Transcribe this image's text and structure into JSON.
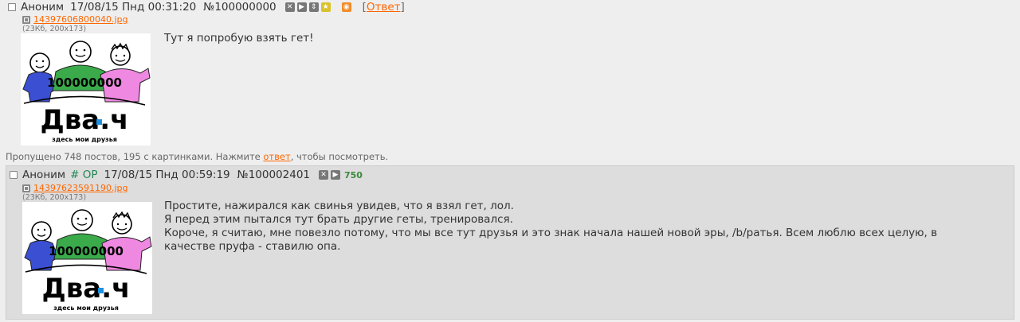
{
  "posts": [
    {
      "name": "Аноним",
      "date": "17/08/15 Пнд 00:31:20",
      "number": "№100000000",
      "reply_link_label": "Ответ",
      "file": {
        "name": "14397606800040.jpg",
        "meta": "(23Кб, 200x173)"
      },
      "message": "Тут я попробую взять гет!",
      "thumb": {
        "number": "100000000",
        "logo": "Два.ч",
        "tagline": "здесь мои друзья"
      }
    },
    {
      "name": "Аноним",
      "tripcode": "# OP",
      "date": "17/08/15 Пнд 00:59:19",
      "number": "№100002401",
      "count": "750",
      "file": {
        "name": "14397623591190.jpg",
        "meta": "(23Кб, 200x173)"
      },
      "message": [
        "Простите, нажирался как свинья увидев, что я взял гет, лол.",
        "Я перед этим пытался тут брать другие геты, тренировался.",
        "Короче, я считаю, мне повезло потому, что мы все тут друзья и это знак начала нашей новой эры, /b/ратья. Всем люблю всех целую, в качестве пруфа - ставилю опа."
      ],
      "thumb": {
        "number": "100000000",
        "logo": "Два.ч",
        "tagline": "здесь мои друзья"
      }
    }
  ],
  "omitted": {
    "before": "Пропущено 748 постов, 195 с картинками. Нажмите ",
    "link": "ответ",
    "after": ", чтобы посмотреть."
  },
  "colors": {
    "link": "#ff6600",
    "reply_bg": "#dddddd",
    "page_bg": "#eeeeee",
    "trip": "#228854"
  },
  "icons": [
    "checkbox",
    "hide-icon",
    "play-icon",
    "expand-icon",
    "star-icon",
    "rss-icon",
    "file-icon"
  ]
}
